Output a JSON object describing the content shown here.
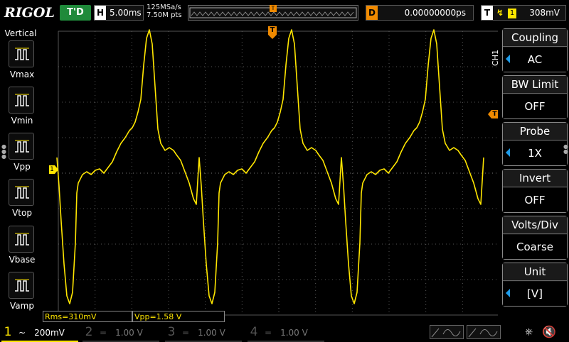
{
  "header": {
    "brand": "RIGOL",
    "run_status": "T'D",
    "timebase_key": "H",
    "timebase_value": "5.00ms",
    "sample_rate": "125MSa/s",
    "memory_depth": "7.50M pts",
    "delay_key": "D",
    "delay_value": "0.00000000ps",
    "trigger_key": "T",
    "trigger_source": "1",
    "trigger_level": "308mV",
    "trigger_marker": "T"
  },
  "left_panel": {
    "title": "Vertical",
    "items": [
      {
        "label": "Vmax",
        "icon": "vmax-icon"
      },
      {
        "label": "Vmin",
        "icon": "vmin-icon"
      },
      {
        "label": "Vpp",
        "icon": "vpp-icon"
      },
      {
        "label": "Vtop",
        "icon": "vtop-icon"
      },
      {
        "label": "Vbase",
        "icon": "vbase-icon"
      },
      {
        "label": "Vamp",
        "icon": "vamp-icon"
      }
    ]
  },
  "right_panel": {
    "channel_tag": "CH1",
    "buttons": [
      {
        "title": "Coupling",
        "value": "AC"
      },
      {
        "title": "BW Limit",
        "value": "OFF"
      },
      {
        "title": "Probe",
        "value": "1X"
      },
      {
        "title": "Invert",
        "value": "OFF"
      },
      {
        "title": "Volts/Div",
        "value": "Coarse"
      },
      {
        "title": "Unit",
        "value": "[V]"
      }
    ]
  },
  "measurements": {
    "rms": "Rms=310mV",
    "vpp": "Vpp=1.58 V"
  },
  "channels": [
    {
      "num": "1",
      "coupling": "~",
      "scale": "200mV",
      "color": "#ffe600"
    },
    {
      "num": "2",
      "coupling": "=",
      "scale": "1.00 V",
      "color": "#00c0c0"
    },
    {
      "num": "3",
      "coupling": "=",
      "scale": "1.00 V",
      "color": "#e040e0"
    },
    {
      "num": "4",
      "coupling": "=",
      "scale": "1.00 V",
      "color": "#2a7ef0"
    }
  ],
  "ch1_ground_marker": "1",
  "colors": {
    "trace": "#ffe600",
    "trigger": "#f08a00",
    "accent": "#1e9be8"
  }
}
